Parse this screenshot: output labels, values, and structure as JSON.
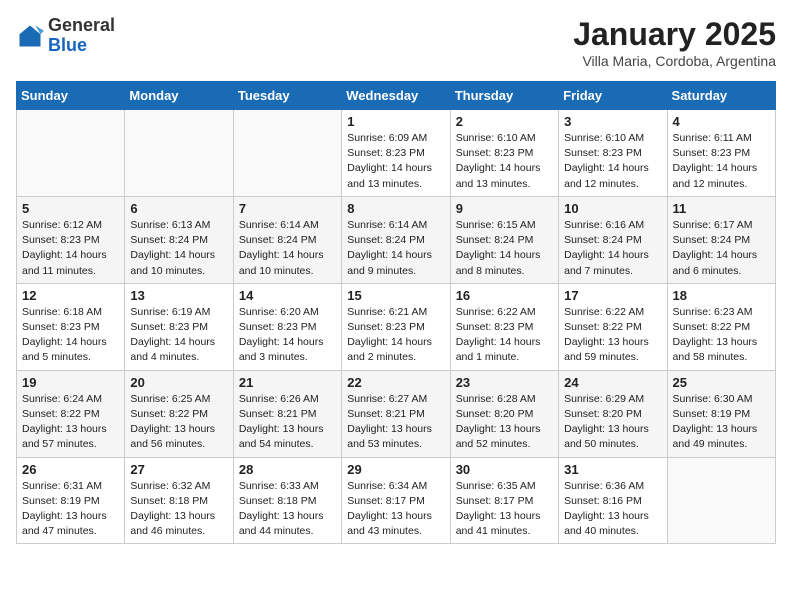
{
  "header": {
    "logo_general": "General",
    "logo_blue": "Blue",
    "month_title": "January 2025",
    "subtitle": "Villa Maria, Cordoba, Argentina"
  },
  "days_of_week": [
    "Sunday",
    "Monday",
    "Tuesday",
    "Wednesday",
    "Thursday",
    "Friday",
    "Saturday"
  ],
  "weeks": [
    [
      {
        "day": "",
        "info": ""
      },
      {
        "day": "",
        "info": ""
      },
      {
        "day": "",
        "info": ""
      },
      {
        "day": "1",
        "info": "Sunrise: 6:09 AM\nSunset: 8:23 PM\nDaylight: 14 hours and 13 minutes."
      },
      {
        "day": "2",
        "info": "Sunrise: 6:10 AM\nSunset: 8:23 PM\nDaylight: 14 hours and 13 minutes."
      },
      {
        "day": "3",
        "info": "Sunrise: 6:10 AM\nSunset: 8:23 PM\nDaylight: 14 hours and 12 minutes."
      },
      {
        "day": "4",
        "info": "Sunrise: 6:11 AM\nSunset: 8:23 PM\nDaylight: 14 hours and 12 minutes."
      }
    ],
    [
      {
        "day": "5",
        "info": "Sunrise: 6:12 AM\nSunset: 8:23 PM\nDaylight: 14 hours and 11 minutes."
      },
      {
        "day": "6",
        "info": "Sunrise: 6:13 AM\nSunset: 8:24 PM\nDaylight: 14 hours and 10 minutes."
      },
      {
        "day": "7",
        "info": "Sunrise: 6:14 AM\nSunset: 8:24 PM\nDaylight: 14 hours and 10 minutes."
      },
      {
        "day": "8",
        "info": "Sunrise: 6:14 AM\nSunset: 8:24 PM\nDaylight: 14 hours and 9 minutes."
      },
      {
        "day": "9",
        "info": "Sunrise: 6:15 AM\nSunset: 8:24 PM\nDaylight: 14 hours and 8 minutes."
      },
      {
        "day": "10",
        "info": "Sunrise: 6:16 AM\nSunset: 8:24 PM\nDaylight: 14 hours and 7 minutes."
      },
      {
        "day": "11",
        "info": "Sunrise: 6:17 AM\nSunset: 8:24 PM\nDaylight: 14 hours and 6 minutes."
      }
    ],
    [
      {
        "day": "12",
        "info": "Sunrise: 6:18 AM\nSunset: 8:23 PM\nDaylight: 14 hours and 5 minutes."
      },
      {
        "day": "13",
        "info": "Sunrise: 6:19 AM\nSunset: 8:23 PM\nDaylight: 14 hours and 4 minutes."
      },
      {
        "day": "14",
        "info": "Sunrise: 6:20 AM\nSunset: 8:23 PM\nDaylight: 14 hours and 3 minutes."
      },
      {
        "day": "15",
        "info": "Sunrise: 6:21 AM\nSunset: 8:23 PM\nDaylight: 14 hours and 2 minutes."
      },
      {
        "day": "16",
        "info": "Sunrise: 6:22 AM\nSunset: 8:23 PM\nDaylight: 14 hours and 1 minute."
      },
      {
        "day": "17",
        "info": "Sunrise: 6:22 AM\nSunset: 8:22 PM\nDaylight: 13 hours and 59 minutes."
      },
      {
        "day": "18",
        "info": "Sunrise: 6:23 AM\nSunset: 8:22 PM\nDaylight: 13 hours and 58 minutes."
      }
    ],
    [
      {
        "day": "19",
        "info": "Sunrise: 6:24 AM\nSunset: 8:22 PM\nDaylight: 13 hours and 57 minutes."
      },
      {
        "day": "20",
        "info": "Sunrise: 6:25 AM\nSunset: 8:22 PM\nDaylight: 13 hours and 56 minutes."
      },
      {
        "day": "21",
        "info": "Sunrise: 6:26 AM\nSunset: 8:21 PM\nDaylight: 13 hours and 54 minutes."
      },
      {
        "day": "22",
        "info": "Sunrise: 6:27 AM\nSunset: 8:21 PM\nDaylight: 13 hours and 53 minutes."
      },
      {
        "day": "23",
        "info": "Sunrise: 6:28 AM\nSunset: 8:20 PM\nDaylight: 13 hours and 52 minutes."
      },
      {
        "day": "24",
        "info": "Sunrise: 6:29 AM\nSunset: 8:20 PM\nDaylight: 13 hours and 50 minutes."
      },
      {
        "day": "25",
        "info": "Sunrise: 6:30 AM\nSunset: 8:19 PM\nDaylight: 13 hours and 49 minutes."
      }
    ],
    [
      {
        "day": "26",
        "info": "Sunrise: 6:31 AM\nSunset: 8:19 PM\nDaylight: 13 hours and 47 minutes."
      },
      {
        "day": "27",
        "info": "Sunrise: 6:32 AM\nSunset: 8:18 PM\nDaylight: 13 hours and 46 minutes."
      },
      {
        "day": "28",
        "info": "Sunrise: 6:33 AM\nSunset: 8:18 PM\nDaylight: 13 hours and 44 minutes."
      },
      {
        "day": "29",
        "info": "Sunrise: 6:34 AM\nSunset: 8:17 PM\nDaylight: 13 hours and 43 minutes."
      },
      {
        "day": "30",
        "info": "Sunrise: 6:35 AM\nSunset: 8:17 PM\nDaylight: 13 hours and 41 minutes."
      },
      {
        "day": "31",
        "info": "Sunrise: 6:36 AM\nSunset: 8:16 PM\nDaylight: 13 hours and 40 minutes."
      },
      {
        "day": "",
        "info": ""
      }
    ]
  ]
}
